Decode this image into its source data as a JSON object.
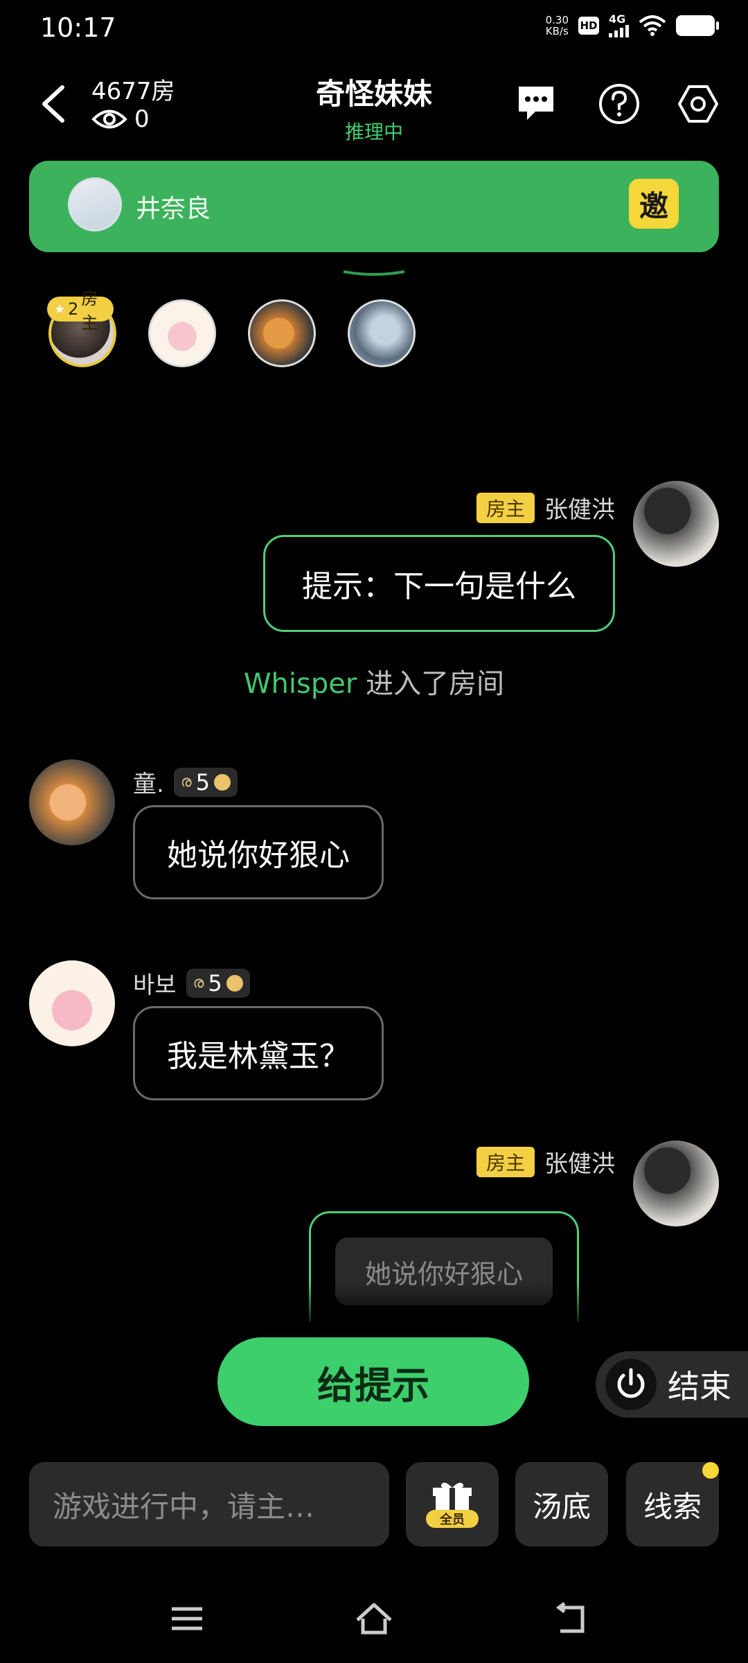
{
  "status_bar": {
    "time": "10:17",
    "net_speed_value": "0.30",
    "net_speed_unit": "KB/s",
    "hd": "HD",
    "network": "4G"
  },
  "header": {
    "room_number": "4677房",
    "viewer_count": "0",
    "title": "奇怪妹妹",
    "status": "推理中"
  },
  "banner": {
    "name": "井奈良",
    "invite_label": "邀"
  },
  "members": {
    "host_tag_count": "2",
    "host_tag_label": "房主"
  },
  "messages": [
    {
      "sender": "张健洪",
      "badge": "房主",
      "text": "提示：下一句是什么"
    },
    {
      "sender": "童.",
      "level": "5",
      "text": "她说你好狠心"
    },
    {
      "sender": "바보",
      "level": "5",
      "text": "我是林黛玉？"
    },
    {
      "sender": "张健洪",
      "badge": "房主",
      "text": "她说你好狠心"
    }
  ],
  "system_message": {
    "who": "Whisper",
    "text": " 进入了房间"
  },
  "actions": {
    "hint_label": "给提示",
    "end_label": "结束"
  },
  "input_bar": {
    "placeholder": "游戏进行中，请主…",
    "gift_badge": "全员",
    "soup_label": "汤底",
    "clue_label": "线索"
  },
  "colors": {
    "accent_green": "#3ecf6d",
    "banner_green": "#3cb25c",
    "host_badge_yellow": "#f3cf43",
    "invite_yellow": "#f6d73a"
  }
}
